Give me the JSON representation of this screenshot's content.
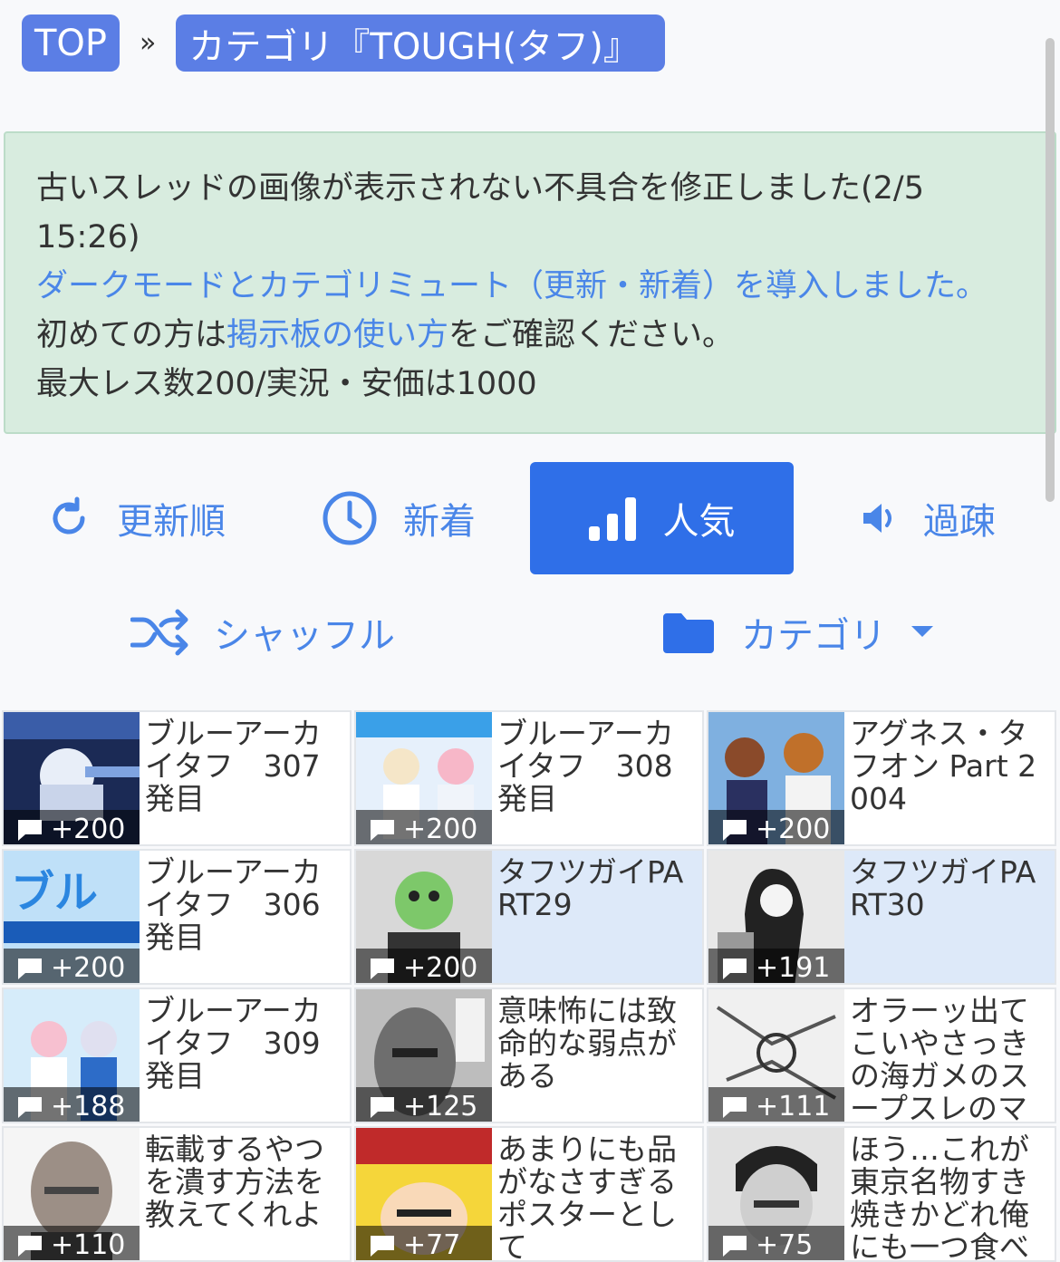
{
  "breadcrumb": {
    "top": "TOP",
    "separator": "»",
    "current": "カテゴリ『TOUGH(タフ)』"
  },
  "notice": {
    "line1": "古いスレッドの画像が表示されない不具合を修正しました(2/5 15:26)",
    "line2": "ダークモードとカテゴリミュート（更新・新着）を導入しました。",
    "line3_pre": "初めての方は",
    "line3_link": "掲示板の使い方",
    "line3_post": "をご確認ください。",
    "line4": "最大レス数200/実況・安価は1000"
  },
  "sort": {
    "updated": "更新順",
    "new": "新着",
    "popular": "人気",
    "archive": "過疎",
    "shuffle": "シャッフル",
    "category": "カテゴリ"
  },
  "threads": [
    {
      "title": "ブルーアーカイタフ　307発目",
      "count": "+200",
      "thumb": "blue-archive-mech"
    },
    {
      "title": "ブルーアーカイタフ　308発目",
      "count": "+200",
      "thumb": "blue-archive-girls"
    },
    {
      "title": "アグネス・タフオン Part 2004",
      "count": "+200",
      "thumb": "horse-girls"
    },
    {
      "title": "ブルーアーカイタフ　306発目",
      "count": "+200",
      "thumb": "blue-archive-logo"
    },
    {
      "title": "タフツガイPART29",
      "count": "+200",
      "thumb": "manga-bird-head"
    },
    {
      "title": "タフツガイPART30",
      "count": "+191",
      "thumb": "manga-girl"
    },
    {
      "title": "ブルーアーカイタフ　309発目",
      "count": "+188",
      "thumb": "blue-archive-chibi"
    },
    {
      "title": "意味怖には致命的な弱点がある",
      "count": "+125",
      "thumb": "manga-face"
    },
    {
      "title": "オラーッ出てこいやさっきの海ガメのスープスレのマ",
      "count": "+111",
      "thumb": "manga-sketch"
    },
    {
      "title": "転載するやつを潰す方法を教えてくれよ",
      "count": "+110",
      "thumb": "bald-man"
    },
    {
      "title": "あまりにも品がなさすぎるポスターとして",
      "count": "+77",
      "thumb": "movie-poster"
    },
    {
      "title": "ほう…これが東京名物すき焼きかどれ俺にも一つ食べ",
      "count": "+75",
      "thumb": "manga-man"
    }
  ],
  "colors": {
    "accent": "#2f6fe8",
    "link": "#4a86e8",
    "crumb": "#5b7ee5",
    "notice_bg": "#d8ecdf",
    "highlight": "#dde9f9"
  }
}
